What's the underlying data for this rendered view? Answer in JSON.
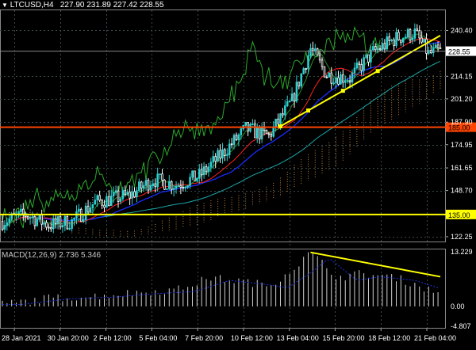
{
  "header": {
    "symbol_tf": "LTCUSD,H4",
    "ohlc": "227.90 231.89 227.42 228.55"
  },
  "macd": {
    "title": "MACD(12,26,9) 2.736 5.346"
  },
  "colors": {
    "background": "#000000",
    "grid": "#3a4a4a",
    "candle_bull": "#2fd0d0",
    "candle_bear": "#ffffff",
    "resistance_line": "#ff4500",
    "support_line": "#ffff00",
    "trendline": "#ffff00",
    "chikou": "#2ca82c",
    "ma_red": "#ff2020",
    "ma_blue": "#1a2cff",
    "ma_teal": "#1aa6a6",
    "cloud": "#c8823a",
    "macd_hist": "#d0d0d0",
    "macd_signal": "#2233dd"
  },
  "chart_data": {
    "type": "candlestick",
    "price_axis": {
      "min": 119.5,
      "max": 251.5,
      "ticks": [
        "240.40",
        "214.15",
        "201.20",
        "187.90",
        "174.95",
        "161.65",
        "148.70",
        "122.25"
      ]
    },
    "current_price": "228.55",
    "levels": [
      {
        "name": "resistance",
        "value": "185.00",
        "color": "#ff4500"
      },
      {
        "name": "support",
        "value": "135.00",
        "color": "#ffff00"
      }
    ],
    "time_labels": [
      "28 Jan 2021",
      "30 Jan 20:00",
      "2 Feb 12:00",
      "5 Feb 04:00",
      "7 Feb 20:00",
      "10 Feb 12:00",
      "13 Feb 04:00",
      "15 Feb 20:00",
      "18 Feb 12:00",
      "21 Feb 04:00"
    ],
    "close_anchors": [
      [
        0,
        131
      ],
      [
        10,
        135
      ],
      [
        20,
        129
      ],
      [
        30,
        131
      ],
      [
        40,
        142
      ],
      [
        55,
        146
      ],
      [
        65,
        155
      ],
      [
        75,
        152
      ],
      [
        85,
        157
      ],
      [
        95,
        170
      ],
      [
        105,
        184
      ],
      [
        115,
        180
      ],
      [
        125,
        200
      ],
      [
        133,
        230
      ],
      [
        140,
        215
      ],
      [
        150,
        213
      ],
      [
        160,
        228
      ],
      [
        170,
        236
      ],
      [
        178,
        239
      ],
      [
        184,
        227
      ],
      [
        190,
        229
      ]
    ],
    "candle_count": 190,
    "macd_axis": {
      "min": -4.807,
      "max": 13.229,
      "ticks": [
        "13.229",
        "0.00",
        "-4.807"
      ]
    },
    "macd_hist_anchors": [
      [
        0,
        0.5
      ],
      [
        20,
        2
      ],
      [
        40,
        2.5
      ],
      [
        60,
        3.5
      ],
      [
        75,
        4
      ],
      [
        90,
        7
      ],
      [
        105,
        6
      ],
      [
        115,
        5
      ],
      [
        125,
        9
      ],
      [
        133,
        13
      ],
      [
        145,
        7
      ],
      [
        155,
        8
      ],
      [
        170,
        7
      ],
      [
        180,
        5
      ],
      [
        190,
        2.7
      ]
    ]
  }
}
